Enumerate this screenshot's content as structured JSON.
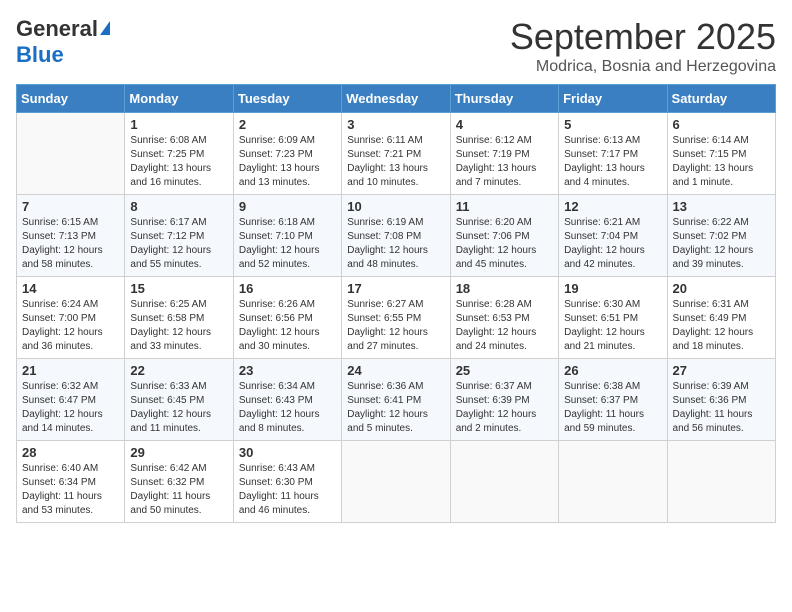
{
  "logo": {
    "general": "General",
    "blue": "Blue"
  },
  "title": "September 2025",
  "location": "Modrica, Bosnia and Herzegovina",
  "days_of_week": [
    "Sunday",
    "Monday",
    "Tuesday",
    "Wednesday",
    "Thursday",
    "Friday",
    "Saturday"
  ],
  "weeks": [
    [
      {
        "day": "",
        "sunrise": "",
        "sunset": "",
        "daylight": ""
      },
      {
        "day": "1",
        "sunrise": "Sunrise: 6:08 AM",
        "sunset": "Sunset: 7:25 PM",
        "daylight": "Daylight: 13 hours and 16 minutes."
      },
      {
        "day": "2",
        "sunrise": "Sunrise: 6:09 AM",
        "sunset": "Sunset: 7:23 PM",
        "daylight": "Daylight: 13 hours and 13 minutes."
      },
      {
        "day": "3",
        "sunrise": "Sunrise: 6:11 AM",
        "sunset": "Sunset: 7:21 PM",
        "daylight": "Daylight: 13 hours and 10 minutes."
      },
      {
        "day": "4",
        "sunrise": "Sunrise: 6:12 AM",
        "sunset": "Sunset: 7:19 PM",
        "daylight": "Daylight: 13 hours and 7 minutes."
      },
      {
        "day": "5",
        "sunrise": "Sunrise: 6:13 AM",
        "sunset": "Sunset: 7:17 PM",
        "daylight": "Daylight: 13 hours and 4 minutes."
      },
      {
        "day": "6",
        "sunrise": "Sunrise: 6:14 AM",
        "sunset": "Sunset: 7:15 PM",
        "daylight": "Daylight: 13 hours and 1 minute."
      }
    ],
    [
      {
        "day": "7",
        "sunrise": "Sunrise: 6:15 AM",
        "sunset": "Sunset: 7:13 PM",
        "daylight": "Daylight: 12 hours and 58 minutes."
      },
      {
        "day": "8",
        "sunrise": "Sunrise: 6:17 AM",
        "sunset": "Sunset: 7:12 PM",
        "daylight": "Daylight: 12 hours and 55 minutes."
      },
      {
        "day": "9",
        "sunrise": "Sunrise: 6:18 AM",
        "sunset": "Sunset: 7:10 PM",
        "daylight": "Daylight: 12 hours and 52 minutes."
      },
      {
        "day": "10",
        "sunrise": "Sunrise: 6:19 AM",
        "sunset": "Sunset: 7:08 PM",
        "daylight": "Daylight: 12 hours and 48 minutes."
      },
      {
        "day": "11",
        "sunrise": "Sunrise: 6:20 AM",
        "sunset": "Sunset: 7:06 PM",
        "daylight": "Daylight: 12 hours and 45 minutes."
      },
      {
        "day": "12",
        "sunrise": "Sunrise: 6:21 AM",
        "sunset": "Sunset: 7:04 PM",
        "daylight": "Daylight: 12 hours and 42 minutes."
      },
      {
        "day": "13",
        "sunrise": "Sunrise: 6:22 AM",
        "sunset": "Sunset: 7:02 PM",
        "daylight": "Daylight: 12 hours and 39 minutes."
      }
    ],
    [
      {
        "day": "14",
        "sunrise": "Sunrise: 6:24 AM",
        "sunset": "Sunset: 7:00 PM",
        "daylight": "Daylight: 12 hours and 36 minutes."
      },
      {
        "day": "15",
        "sunrise": "Sunrise: 6:25 AM",
        "sunset": "Sunset: 6:58 PM",
        "daylight": "Daylight: 12 hours and 33 minutes."
      },
      {
        "day": "16",
        "sunrise": "Sunrise: 6:26 AM",
        "sunset": "Sunset: 6:56 PM",
        "daylight": "Daylight: 12 hours and 30 minutes."
      },
      {
        "day": "17",
        "sunrise": "Sunrise: 6:27 AM",
        "sunset": "Sunset: 6:55 PM",
        "daylight": "Daylight: 12 hours and 27 minutes."
      },
      {
        "day": "18",
        "sunrise": "Sunrise: 6:28 AM",
        "sunset": "Sunset: 6:53 PM",
        "daylight": "Daylight: 12 hours and 24 minutes."
      },
      {
        "day": "19",
        "sunrise": "Sunrise: 6:30 AM",
        "sunset": "Sunset: 6:51 PM",
        "daylight": "Daylight: 12 hours and 21 minutes."
      },
      {
        "day": "20",
        "sunrise": "Sunrise: 6:31 AM",
        "sunset": "Sunset: 6:49 PM",
        "daylight": "Daylight: 12 hours and 18 minutes."
      }
    ],
    [
      {
        "day": "21",
        "sunrise": "Sunrise: 6:32 AM",
        "sunset": "Sunset: 6:47 PM",
        "daylight": "Daylight: 12 hours and 14 minutes."
      },
      {
        "day": "22",
        "sunrise": "Sunrise: 6:33 AM",
        "sunset": "Sunset: 6:45 PM",
        "daylight": "Daylight: 12 hours and 11 minutes."
      },
      {
        "day": "23",
        "sunrise": "Sunrise: 6:34 AM",
        "sunset": "Sunset: 6:43 PM",
        "daylight": "Daylight: 12 hours and 8 minutes."
      },
      {
        "day": "24",
        "sunrise": "Sunrise: 6:36 AM",
        "sunset": "Sunset: 6:41 PM",
        "daylight": "Daylight: 12 hours and 5 minutes."
      },
      {
        "day": "25",
        "sunrise": "Sunrise: 6:37 AM",
        "sunset": "Sunset: 6:39 PM",
        "daylight": "Daylight: 12 hours and 2 minutes."
      },
      {
        "day": "26",
        "sunrise": "Sunrise: 6:38 AM",
        "sunset": "Sunset: 6:37 PM",
        "daylight": "Daylight: 11 hours and 59 minutes."
      },
      {
        "day": "27",
        "sunrise": "Sunrise: 6:39 AM",
        "sunset": "Sunset: 6:36 PM",
        "daylight": "Daylight: 11 hours and 56 minutes."
      }
    ],
    [
      {
        "day": "28",
        "sunrise": "Sunrise: 6:40 AM",
        "sunset": "Sunset: 6:34 PM",
        "daylight": "Daylight: 11 hours and 53 minutes."
      },
      {
        "day": "29",
        "sunrise": "Sunrise: 6:42 AM",
        "sunset": "Sunset: 6:32 PM",
        "daylight": "Daylight: 11 hours and 50 minutes."
      },
      {
        "day": "30",
        "sunrise": "Sunrise: 6:43 AM",
        "sunset": "Sunset: 6:30 PM",
        "daylight": "Daylight: 11 hours and 46 minutes."
      },
      {
        "day": "",
        "sunrise": "",
        "sunset": "",
        "daylight": ""
      },
      {
        "day": "",
        "sunrise": "",
        "sunset": "",
        "daylight": ""
      },
      {
        "day": "",
        "sunrise": "",
        "sunset": "",
        "daylight": ""
      },
      {
        "day": "",
        "sunrise": "",
        "sunset": "",
        "daylight": ""
      }
    ]
  ]
}
